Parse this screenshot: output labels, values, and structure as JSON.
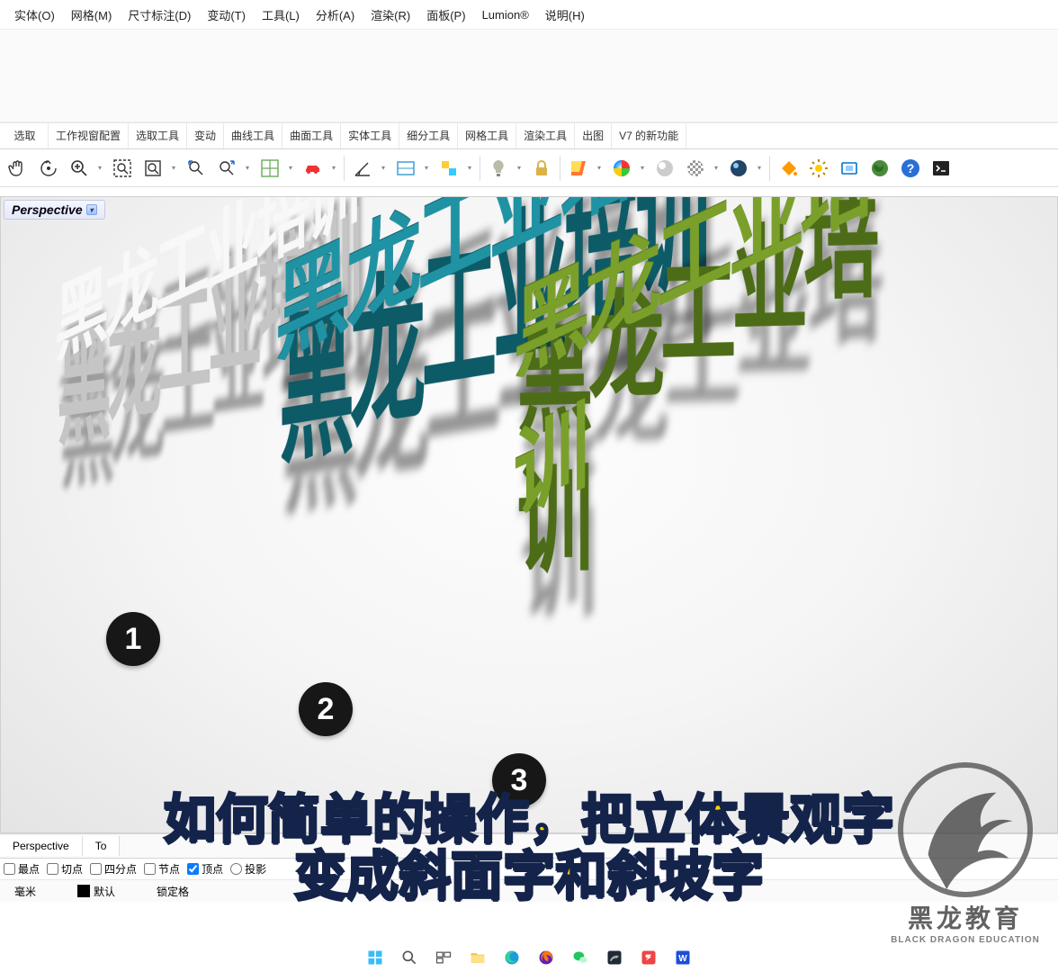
{
  "menu": {
    "items": [
      "实体(O)",
      "网格(M)",
      "尺寸标注(D)",
      "变动(T)",
      "工具(L)",
      "分析(A)",
      "渲染(R)",
      "面板(P)",
      "Lumion®",
      "说明(H)"
    ]
  },
  "tooltabs": {
    "items": [
      "选取",
      "工作视窗配置",
      "选取工具",
      "变动",
      "曲线工具",
      "曲面工具",
      "实体工具",
      "细分工具",
      "网格工具",
      "渲染工具",
      "出图",
      "V7 的新功能"
    ]
  },
  "viewport": {
    "title": "Perspective",
    "badges": {
      "b1": "1",
      "b2": "2",
      "b3": "3"
    },
    "model_text": "黑龙工业培训"
  },
  "toolbar_icons": [
    "pan-hand-icon",
    "rotate-view-icon",
    "zoom-dynamic-icon",
    "zoom-window-icon",
    "zoom-extents-icon",
    "undo-view-icon",
    "redo-view-icon",
    "cplane-icon",
    "car-icon",
    "angle-icon",
    "rect-layout-icon",
    "corner-icon",
    "lightbulb-icon",
    "lock-icon",
    "layer-swatch-icon",
    "color-wheel-icon",
    "sphere-shade-icon",
    "uv-sphere-icon",
    "render-sphere-icon",
    "paintbucket-icon",
    "gear-sun-icon",
    "align-icon",
    "globe-icon",
    "help-icon",
    "terminal-icon"
  ],
  "bottom_tabs": {
    "t1": "Perspective",
    "t2": "To"
  },
  "osnap": {
    "o1": "最点",
    "o2": "切点",
    "o3": "四分点",
    "o4": "节点",
    "o5": "顶点",
    "o6": "投影"
  },
  "status": {
    "s1": "毫米",
    "s2": "默认",
    "s3": "锁定格"
  },
  "caption": {
    "line1": "如何简单的操作，把立体景观字",
    "line2": "变成斜面字和斜坡字"
  },
  "watermark": {
    "t1": "黑龙教育",
    "t2": "BLACK DRAGON EDUCATION"
  },
  "taskbar_icons": [
    "windows-start-icon",
    "search-icon",
    "task-view-icon",
    "explorer-icon",
    "edge-icon",
    "firefox-icon",
    "wechat-icon",
    "rhino-icon",
    "converter-icon",
    "word-icon"
  ]
}
